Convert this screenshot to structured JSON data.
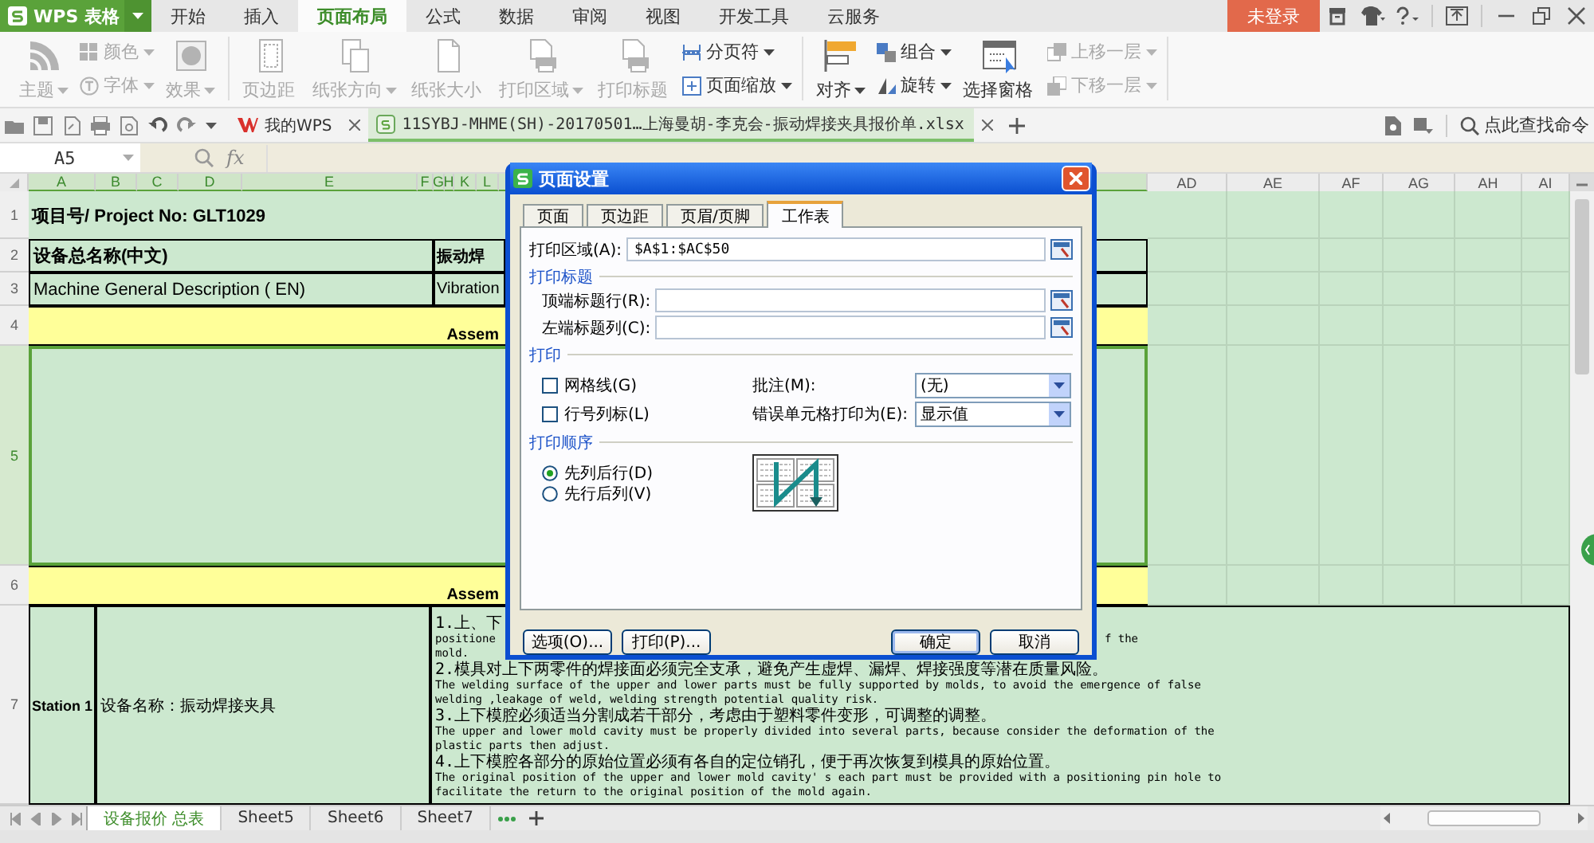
{
  "title_bar": {
    "app_menu": "WPS 表格",
    "tabs": [
      {
        "label": "开始",
        "selected": false
      },
      {
        "label": "插入",
        "selected": false
      },
      {
        "label": "页面布局",
        "selected": true
      },
      {
        "label": "公式",
        "selected": false
      },
      {
        "label": "数据",
        "selected": false
      },
      {
        "label": "审阅",
        "selected": false
      },
      {
        "label": "视图",
        "selected": false
      },
      {
        "label": "开发工具",
        "selected": false
      },
      {
        "label": "云服务",
        "selected": false
      }
    ],
    "login_button": "未登录"
  },
  "ribbon": {
    "groups": [
      {
        "items": [
          {
            "kind": "large",
            "label": "主题",
            "disabled": true,
            "dropdown": true
          },
          {
            "kind": "small",
            "label": "颜色",
            "disabled": true,
            "dropdown": true
          },
          {
            "kind": "small",
            "label": "字体",
            "disabled": true,
            "dropdown": true
          },
          {
            "kind": "large",
            "label": "效果",
            "disabled": true,
            "dropdown": true
          }
        ]
      },
      {
        "items": [
          {
            "kind": "large",
            "label": "页边距",
            "disabled": true,
            "dropdown": false
          },
          {
            "kind": "large",
            "label": "纸张方向",
            "disabled": true,
            "dropdown": true
          },
          {
            "kind": "large",
            "label": "纸张大小",
            "disabled": true,
            "dropdown": false
          },
          {
            "kind": "large",
            "label": "打印区域",
            "disabled": true,
            "dropdown": true
          },
          {
            "kind": "large",
            "label": "打印标题",
            "disabled": true,
            "dropdown": false
          },
          {
            "kind": "small",
            "label": "分页符",
            "disabled": false,
            "dropdown": true
          },
          {
            "kind": "small",
            "label": "页面缩放",
            "disabled": false,
            "dropdown": true
          }
        ]
      },
      {
        "items": [
          {
            "kind": "large",
            "label": "对齐",
            "disabled": false,
            "dropdown": true
          },
          {
            "kind": "small",
            "label": "组合",
            "disabled": false,
            "dropdown": true
          },
          {
            "kind": "small",
            "label": "旋转",
            "disabled": false,
            "dropdown": true
          },
          {
            "kind": "large",
            "label": "选择窗格",
            "disabled": false,
            "dropdown": false
          },
          {
            "kind": "small",
            "label": "上移一层",
            "disabled": true,
            "dropdown": true
          },
          {
            "kind": "small",
            "label": "下移一层",
            "disabled": true,
            "dropdown": true
          }
        ]
      }
    ]
  },
  "document_tabs": {
    "tabs": [
      {
        "label": "我的WPS",
        "selected": false
      },
      {
        "label": "11SYBJ-MHME(SH)-20170501…上海曼胡-李克会-振动焊接夹具报价单.xlsx",
        "selected": true
      }
    ],
    "command_search": "点此查找命令"
  },
  "formula_bar": {
    "name_box": "A5",
    "function_label": "fx"
  },
  "sheet": {
    "columns": [
      "A",
      "B",
      "C",
      "D",
      "E",
      "F",
      "G",
      "H",
      "K",
      "L"
    ],
    "right_columns": [
      "AD",
      "AE",
      "AF",
      "AG",
      "AH",
      "AI"
    ],
    "rows": [
      {
        "number": "1",
        "selected": false,
        "kind": "title",
        "label": "项目号/ Project No: GLT1029"
      },
      {
        "number": "2",
        "selected": false,
        "kind": "pair",
        "bold": true,
        "label": "设备总名称(中文)",
        "value": "振动焊"
      },
      {
        "number": "3",
        "selected": false,
        "kind": "pair",
        "bold": false,
        "label": "Machine General Description ( EN)",
        "value": "Vibration"
      },
      {
        "number": "4",
        "selected": false,
        "kind": "banner",
        "text": "Assem"
      },
      {
        "number": "5",
        "selected": true,
        "kind": "blank"
      },
      {
        "number": "6",
        "selected": false,
        "kind": "banner",
        "text": "Assem"
      },
      {
        "number": "7",
        "selected": false,
        "kind": "station",
        "station": "Station 1",
        "description": "设备名称：振动焊接夹具",
        "notes": [
          {
            "kind": "zh",
            "text": "1.上、下"
          },
          {
            "kind": "en",
            "text": "positione",
            "tail": "f the"
          },
          {
            "kind": "en",
            "text": "mold."
          },
          {
            "kind": "zh",
            "text": "2.模具对上下两零件的焊接面必须完全支承，避免产生虚焊、漏焊、焊接强度等潜在质量风险。"
          },
          {
            "kind": "en",
            "text": "The welding surface of the upper and lower parts must be fully supported by molds, to avoid the emergence of false"
          },
          {
            "kind": "en",
            "text": "welding ,leakage of weld, welding strength potential quality risk."
          },
          {
            "kind": "zh",
            "text": "3.上下模腔必须适当分割成若干部分，考虑由于塑料零件变形，可调整的调整。"
          },
          {
            "kind": "en",
            "text": "The upper and lower mold cavity must be properly divided into several parts, because consider the deformation of the"
          },
          {
            "kind": "en",
            "text": "plastic parts then adjust."
          },
          {
            "kind": "zh",
            "text": "4.上下模腔各部分的原始位置必须有各自的定位销孔，便于再次恢复到模具的原始位置。"
          },
          {
            "kind": "en",
            "text": "The original position of the upper and lower mold cavity' s each part must be provided with a positioning pin hole to"
          },
          {
            "kind": "en",
            "text": "facilitate the return to the original position of the mold again."
          }
        ]
      }
    ]
  },
  "sheet_tabs": [
    {
      "label": "设备报价 总表",
      "selected": true
    },
    {
      "label": "Sheet5",
      "selected": false
    },
    {
      "label": "Sheet6",
      "selected": false
    },
    {
      "label": "Sheet7",
      "selected": false
    }
  ],
  "dialog": {
    "title": "页面设置",
    "tabs": [
      {
        "label": "页面",
        "selected": false
      },
      {
        "label": "页边距",
        "selected": false
      },
      {
        "label": "页眉/页脚",
        "selected": false
      },
      {
        "label": "工作表",
        "selected": true
      }
    ],
    "print_area": {
      "label": "打印区域(A):",
      "value": "$A$1:$AC$50"
    },
    "print_titles": {
      "heading": "打印标题",
      "fields": [
        {
          "label": "顶端标题行(R):"
        },
        {
          "label": "左端标题列(C):"
        }
      ]
    },
    "print": {
      "heading": "打印",
      "options": [
        {
          "label": "网格线(G)",
          "checked": false
        },
        {
          "label": "行号列标(L)",
          "checked": false
        }
      ],
      "selects": [
        {
          "label": "批注(M):",
          "value": "(无)"
        },
        {
          "label": "错误单元格打印为(E):",
          "value": "显示值"
        }
      ]
    },
    "page_order": {
      "heading": "打印顺序",
      "options": [
        {
          "label": "先列后行(D)",
          "selected": true
        },
        {
          "label": "先行后列(V)",
          "selected": false
        }
      ]
    },
    "buttons": [
      {
        "label": "选项(O)...",
        "kind": "left",
        "default": false
      },
      {
        "label": "打印(P)...",
        "kind": "left",
        "default": false
      },
      {
        "label": "确定",
        "kind": "right",
        "default": true
      },
      {
        "label": "取消",
        "kind": "right",
        "default": false
      }
    ]
  }
}
